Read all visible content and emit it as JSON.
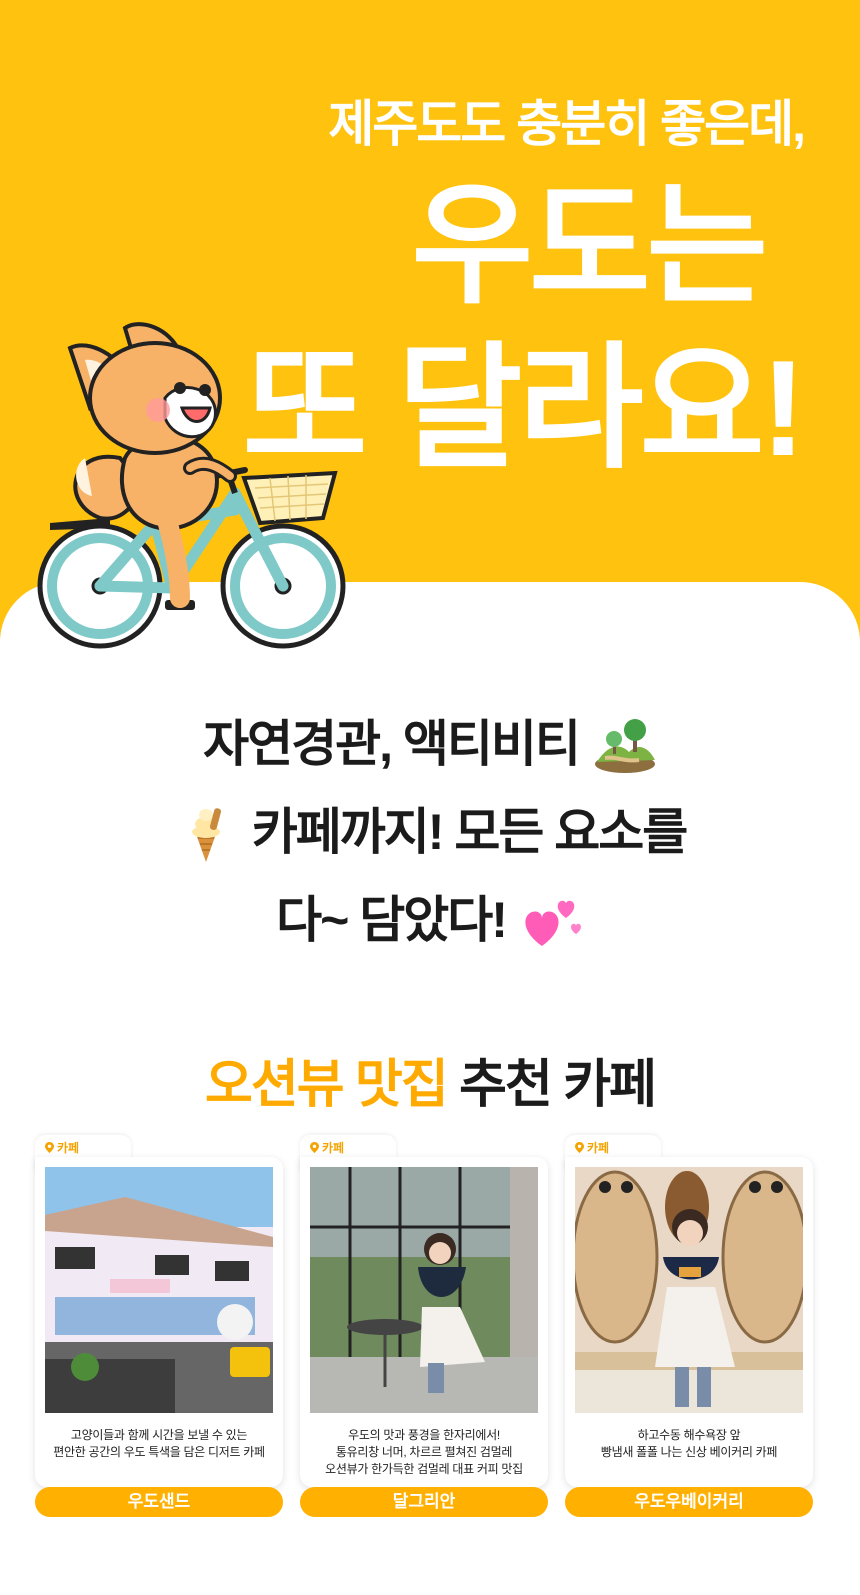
{
  "hero": {
    "subtitle": "제주도도 충분히 좋은데,",
    "title_line1": "우도는",
    "title_line2": "또 달라요!",
    "background_color": "#ffc20e"
  },
  "mascot": {
    "icon": "fox-riding-bicycle-icon"
  },
  "intro": {
    "line1": "자연경관, 액티비티",
    "line1_icon": "hills-trees-icon",
    "line2_icon": "ice-cream-icon",
    "line2": "카페까지! 모든 요소를",
    "line3": "다~ 담았다!",
    "line3_icon": "two-hearts-icon"
  },
  "section": {
    "title_accent": "오션뷰 맛집",
    "title_rest": "추천 카페",
    "accent_color": "#ffaa00"
  },
  "cards": [
    {
      "tag": "카페",
      "photo_icon": "cafe-building-photo",
      "desc": [
        "고양이들과 함께 시간을 보낼 수 있는",
        "편안한 공간의 우도 특색을 담은 디저트 카페"
      ],
      "name": "우도샌드"
    },
    {
      "tag": "카페",
      "photo_icon": "woman-window-cafe-photo",
      "desc": [
        "우도의 맛과 풍경을 한자리에서!",
        "통유리창 너머, 차르르 펼쳐진 검멀레",
        "오션뷰가 한가득한 검멀레 대표 커피 맛집"
      ],
      "name": "달그리안"
    },
    {
      "tag": "카페",
      "photo_icon": "peanut-mural-photo",
      "desc": [
        "하고수동 해수욕장 앞",
        "빵냄새 폴폴 나는 신상 베이커리 카페"
      ],
      "name": "우도우베이커리"
    }
  ]
}
